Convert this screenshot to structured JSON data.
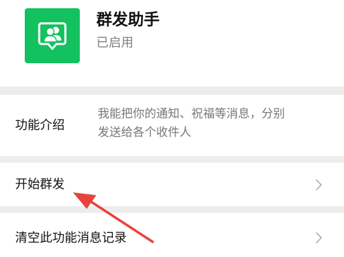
{
  "app": {
    "name": "群发助手",
    "status": "已启用",
    "icon": "group-send-icon",
    "accent_color": "#13c15f"
  },
  "intro": {
    "label": "功能介绍",
    "description_line1": "我能把你的通知、祝福等消息，分别",
    "description_line2": "发送给各个收件人"
  },
  "actions": {
    "start_label": "开始群发",
    "clear_label": "清空此功能消息记录"
  },
  "annotation": {
    "arrow_color": "#e8423b"
  }
}
